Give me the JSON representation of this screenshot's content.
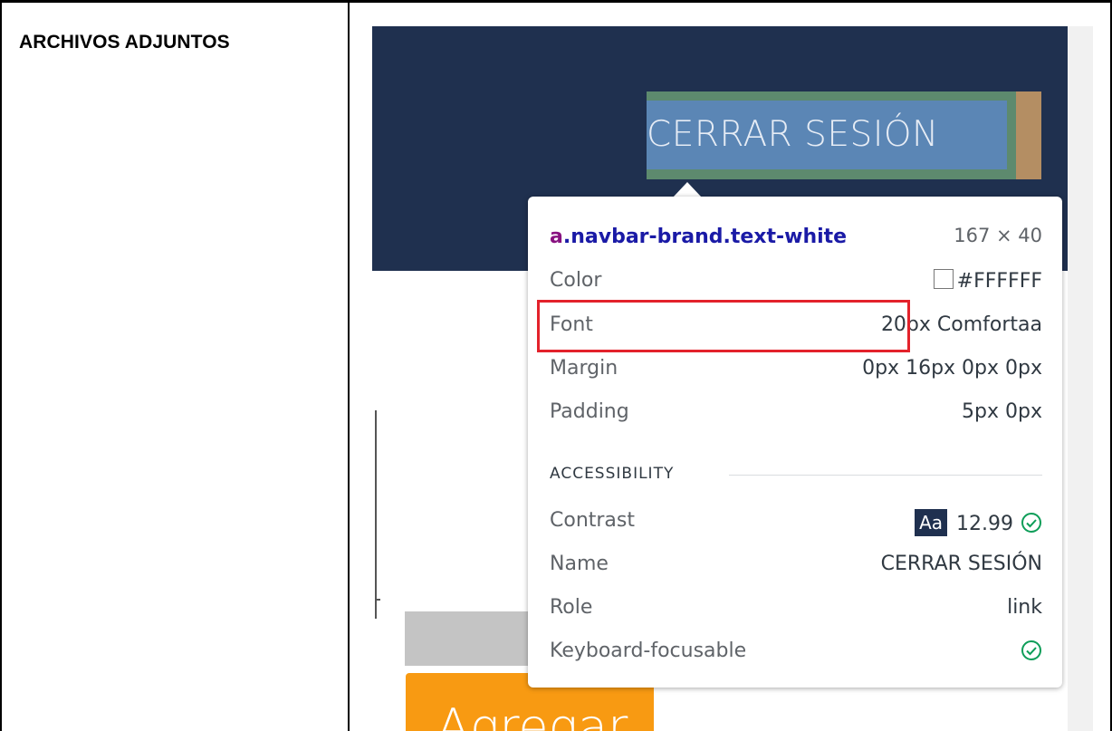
{
  "document": {
    "cell_label": "ARCHIVOS ADJUNTOS"
  },
  "app": {
    "navbar_link_text": "CERRAR SESIÓN",
    "button_text": "Agregar",
    "navbar_color": "#1f304f",
    "button_color": "#f89a12"
  },
  "tooltip": {
    "selector_tag": "a",
    "selector_rest": ".navbar-brand.text-white",
    "size": "167 × 40",
    "rows": [
      {
        "key": "Color",
        "value": "#FFFFFF"
      },
      {
        "key": "Font",
        "value": "20px Comfortaa"
      },
      {
        "key": "Margin",
        "value": "0px 16px 0px 0px"
      },
      {
        "key": "Padding",
        "value": "5px 0px"
      }
    ],
    "accessibility": {
      "heading": "ACCESSIBILITY",
      "contrast_label": "Contrast",
      "contrast_badge": "Aa",
      "contrast_value": "12.99",
      "name_label": "Name",
      "name_value": "CERRAR SESIÓN",
      "role_label": "Role",
      "role_value": "link",
      "keyboard_label": "Keyboard-focusable"
    }
  },
  "annotation": {
    "highlight_color": "#e3222b"
  },
  "icons": {
    "check": "check-circle-icon",
    "swatch": "color-swatch-icon"
  }
}
